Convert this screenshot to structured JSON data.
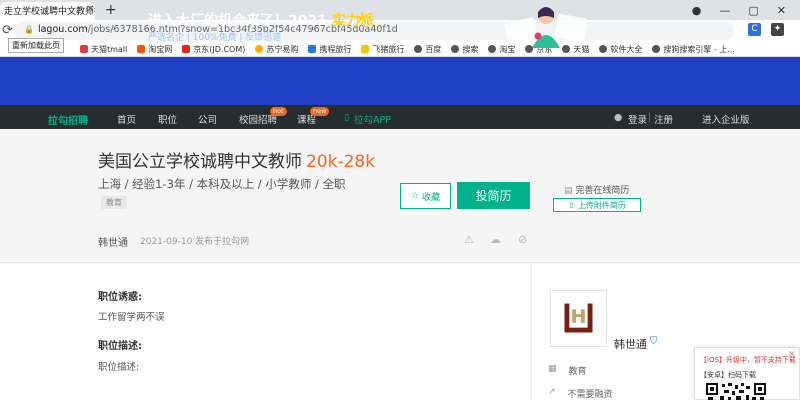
{
  "browser": {
    "tab_title": "走立学校诚聘中文教师招聘-",
    "tab_close": "✕",
    "new_tab": "+",
    "window_controls": [
      "●",
      "—",
      "▢",
      "✕"
    ],
    "url_host": "lagou.com",
    "url_path": "/jobs/6378166.html?show=1bc34f35b2f54c47967cbf45d0a40f1d",
    "reload_tooltip": "重新加载此页",
    "bookmarks": [
      {
        "label": "天猫tmall",
        "color": "#e4393c"
      },
      {
        "label": "淘宝网",
        "color": "#ff5000"
      },
      {
        "label": "京东(JD.COM)",
        "color": "#e1251b"
      },
      {
        "label": "苏宁易购",
        "color": "#ffaa00"
      },
      {
        "label": "携程旅行",
        "color": "#2577e3"
      },
      {
        "label": "飞猪旅行",
        "color": "#ffc300"
      },
      {
        "label": "百度",
        "color": "#555555"
      },
      {
        "label": "搜索",
        "color": "#555555"
      },
      {
        "label": "淘宝",
        "color": "#555555"
      },
      {
        "label": "京东",
        "color": "#555555"
      },
      {
        "label": "天猫",
        "color": "#555555"
      },
      {
        "label": "软件大全",
        "color": "#555555"
      },
      {
        "label": "搜狗搜索引擎 - 上...",
        "color": "#555555"
      }
    ]
  },
  "banner": {
    "title_a": "进入大厂的机会来了！2021",
    "title_b": "实力派",
    "subtitle": "严选名企  |  100%免费  |  反馈迅速"
  },
  "nav": {
    "logo": "拉勾招聘",
    "items": [
      "首页",
      "职位",
      "公司",
      "校园招聘",
      "课程"
    ],
    "hot_badge": "hot",
    "new_badge": "new",
    "app": "拉勾APP",
    "login": "登录",
    "register": "注册",
    "enterprise": "进入企业版",
    "sep": "|"
  },
  "job": {
    "title": "美国公立学校诚聘中文教师",
    "salary": "20k-28k",
    "requirements": "上海 / 经验1-3年 / 本科及以上 / 小学教师 / 全职",
    "tag": "教育",
    "favorite": "收藏",
    "apply": "投简历",
    "complete_resume": "完善在线简历",
    "upload_resume": "上传附件简历",
    "publisher": "韩世通",
    "published": "2021-09-10  发布于拉勾网"
  },
  "detail": {
    "perks_heading": "职位诱惑:",
    "perks_text": "工作留学两不误",
    "desc_heading": "职位描述:",
    "desc_text": "职位描述:"
  },
  "company": {
    "name": "韩世通",
    "industry": "教育",
    "financing": "不需要融资"
  },
  "download": {
    "ios": "【iOS】升级中，暂不支持下载",
    "android": "【安卓】扫码下载",
    "close": "✕"
  },
  "colors": {
    "accent": "#00b38a",
    "salary": "#fd661f",
    "banner_bg": "#1f3fc4",
    "nav_bg": "#262d31"
  }
}
